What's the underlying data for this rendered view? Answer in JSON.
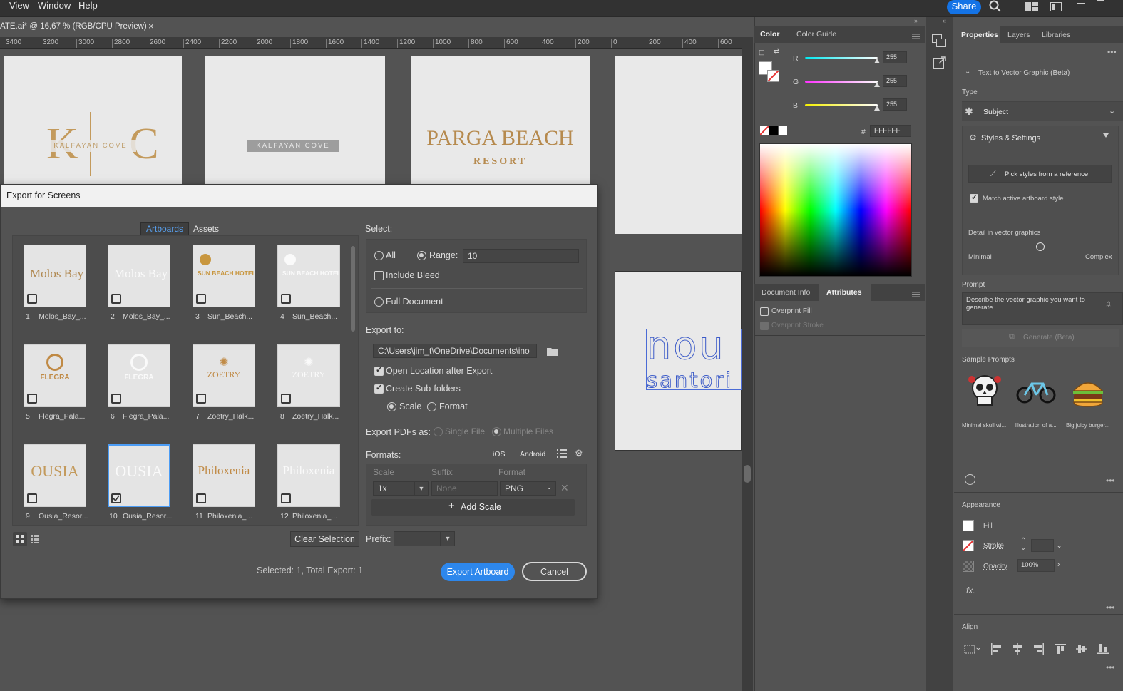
{
  "menu": {
    "items": [
      "View",
      "Window",
      "Help"
    ],
    "share": "Share"
  },
  "document": {
    "tab_title": "ATE.ai* @ 16,67 % (RGB/CPU Preview)",
    "close": "×"
  },
  "ruler": {
    "ticks": [
      "3400",
      "3200",
      "3000",
      "2800",
      "2600",
      "2400",
      "2200",
      "2000",
      "1800",
      "1600",
      "1400",
      "1200",
      "1000",
      "800",
      "600",
      "400",
      "200",
      "0",
      "200",
      "400",
      "600"
    ]
  },
  "canvas": {
    "kc_letters": "K C",
    "kc_sub": "KALFAYAN COVE",
    "kc2_sub": "KALFAYAN COVE",
    "parga_title": "PARGA BEACH",
    "parga_sub": "RESORT",
    "nou_line1": "nou",
    "nou_line2": "santori"
  },
  "dialog": {
    "title": "Export for Screens",
    "tabs": {
      "artboards": "Artboards",
      "assets": "Assets"
    },
    "thumbs": [
      {
        "num": "1",
        "name": "Molos_Bay_...",
        "logo": "Molos Bay",
        "checked": false
      },
      {
        "num": "2",
        "name": "Molos_Bay_...",
        "logo": "Molos Bay",
        "checked": false
      },
      {
        "num": "3",
        "name": "Sun_Beach...",
        "logo": "SUN BEACH HOTEL",
        "checked": false
      },
      {
        "num": "4",
        "name": "Sun_Beach...",
        "logo": "SUN BEACH HOTEL",
        "checked": false
      },
      {
        "num": "5",
        "name": "Flegra_Pala...",
        "logo": "FLEGRA",
        "checked": false
      },
      {
        "num": "6",
        "name": "Flegra_Pala...",
        "logo": "FLEGRA",
        "checked": false
      },
      {
        "num": "7",
        "name": "Zoetry_Halk...",
        "logo": "ZOETRY",
        "checked": false
      },
      {
        "num": "8",
        "name": "Zoetry_Halk...",
        "logo": "ZOETRY",
        "checked": false
      },
      {
        "num": "9",
        "name": "Ousia_Resor...",
        "logo": "OUSIA",
        "checked": false
      },
      {
        "num": "10",
        "name": "Ousia_Resor...",
        "logo": "OUSIA",
        "checked": true
      },
      {
        "num": "11",
        "name": "Philoxenia_...",
        "logo": "Philoxenia",
        "checked": false
      },
      {
        "num": "12",
        "name": "Philoxenia_...",
        "logo": "Philoxenia",
        "checked": false
      }
    ],
    "clear_selection": "Clear Selection",
    "select_label": "Select:",
    "all": "All",
    "range": "Range:",
    "range_value": "10",
    "include_bleed": "Include Bleed",
    "full_document": "Full Document",
    "export_to_label": "Export to:",
    "export_path": "C:\\Users\\jim_t\\OneDrive\\Documents\\ino",
    "open_location": "Open Location after Export",
    "create_subfolders": "Create Sub-folders",
    "scale": "Scale",
    "format": "Format",
    "export_pdfs_as": "Export PDFs as:",
    "single_file": "Single File",
    "multiple_files": "Multiple Files",
    "formats_label": "Formats:",
    "ios": "iOS",
    "android": "Android",
    "col_scale": "Scale",
    "col_suffix": "Suffix",
    "col_format": "Format",
    "scale_value": "1x",
    "suffix_placeholder": "None",
    "format_value": "PNG",
    "add_scale": "Add Scale",
    "prefix_label": "Prefix:",
    "status": "Selected: 1, Total Export: 1",
    "export_button": "Export Artboard",
    "cancel_button": "Cancel"
  },
  "color_panel": {
    "tabs": [
      "Color",
      "Color Guide"
    ],
    "r_label": "R",
    "g_label": "G",
    "b_label": "B",
    "r": "255",
    "g": "255",
    "b": "255",
    "hash": "#",
    "hex": "FFFFFF"
  },
  "attributes_panel": {
    "tabs": [
      "Document Info",
      "Attributes"
    ],
    "overprint_fill": "Overprint Fill",
    "overprint_stroke": "Overprint Stroke"
  },
  "properties": {
    "tabs": [
      "Properties",
      "Layers",
      "Libraries"
    ],
    "section": "Text to Vector Graphic (Beta)",
    "type_label": "Type",
    "type_value": "Subject",
    "styles": "Styles & Settings",
    "pick_styles": "Pick styles from a reference",
    "match_style": "Match active artboard style",
    "detail_label": "Detail in vector graphics",
    "minimal": "Minimal",
    "complex": "Complex",
    "prompt_label": "Prompt",
    "prompt_placeholder": "Describe the vector graphic you want to generate",
    "generate": "Generate (Beta)",
    "sample_prompts": "Sample Prompts",
    "samples": [
      "Minimal skull wi...",
      "Illustration of a...",
      "Big juicy burger..."
    ],
    "appearance": "Appearance",
    "fill": "Fill",
    "stroke": "Stroke",
    "opacity": "Opacity",
    "opacity_value": "100%",
    "fx": "fx.",
    "align": "Align"
  }
}
